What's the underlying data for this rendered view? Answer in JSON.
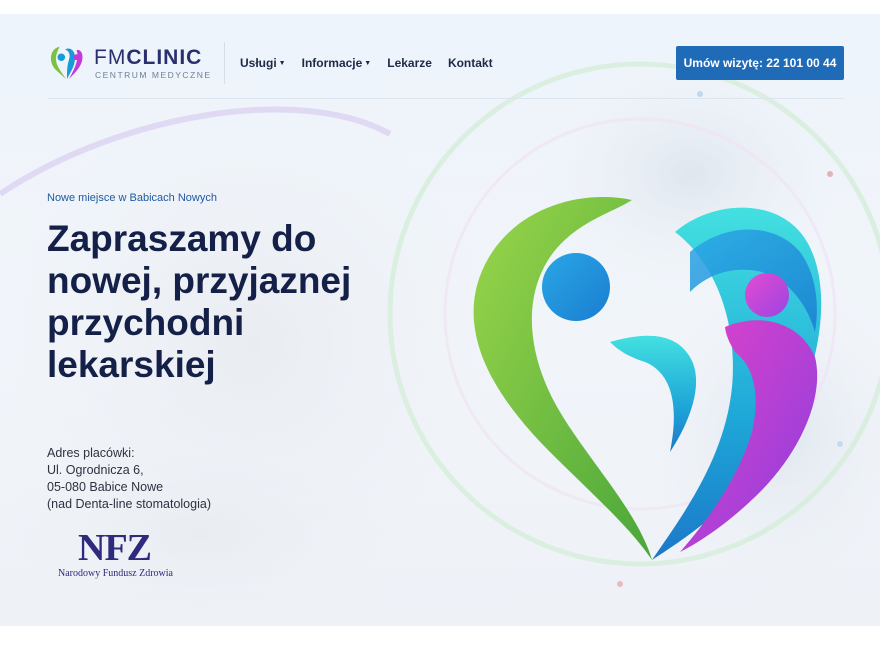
{
  "brand": {
    "name_thin": "FM",
    "name_bold": "CLINIC",
    "subtitle": "CENTRUM MEDYCZNE"
  },
  "nav": {
    "items": [
      {
        "label": "Usługi",
        "dropdown": true
      },
      {
        "label": "Informacje",
        "dropdown": true
      },
      {
        "label": "Lekarze",
        "dropdown": false
      },
      {
        "label": "Kontakt",
        "dropdown": false
      }
    ],
    "cta_label": "Umów wizytę: 22 101 00 44"
  },
  "hero": {
    "eyebrow": "Nowe miejsce w Babicach Nowych",
    "headline": "Zapraszamy do nowej, przyjaznej przychodni lekarskiej",
    "address": {
      "label": "Adres placówki:",
      "street": "Ul. Ogrodnicza 6,",
      "city": "05-080 Babice Nowe",
      "note": "(nad Denta-line stomatologia)"
    }
  },
  "nfz": {
    "letters": "NFZ",
    "name": "Narodowy Fundusz Zdrowia"
  },
  "colors": {
    "accent": "#1f6bb8",
    "heading": "#142047",
    "logo_green": "#7cc242",
    "logo_blue": "#1a9ad6",
    "logo_cyan": "#3fd1d9",
    "logo_magenta": "#c43ad8"
  }
}
